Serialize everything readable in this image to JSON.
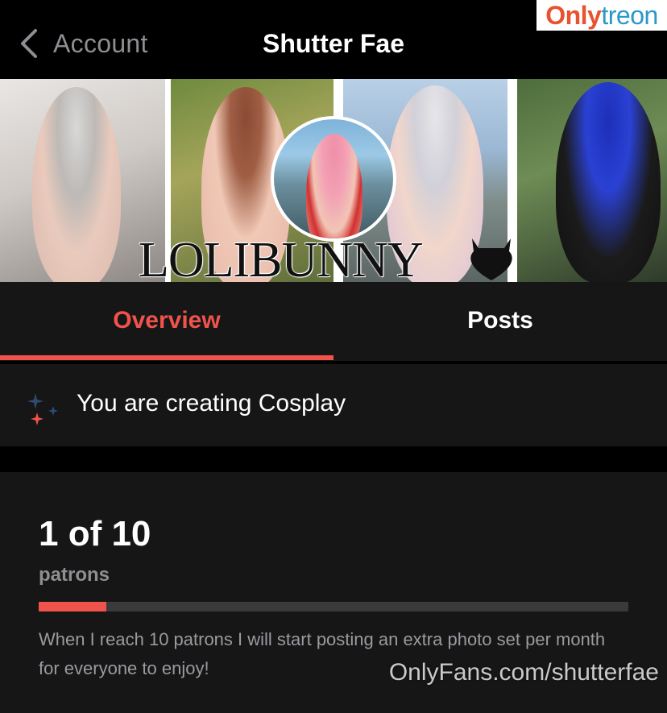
{
  "nav": {
    "back_label": "Account",
    "title": "Shutter Fae"
  },
  "watermark_top": {
    "part1": "Only",
    "part2": "treon"
  },
  "banner": {
    "text": "LOLIBUNNY"
  },
  "tabs": [
    {
      "label": "Overview",
      "active": true
    },
    {
      "label": "Posts",
      "active": false
    }
  ],
  "creating": {
    "text": "You are creating Cosplay",
    "icon": "sparkle-icon"
  },
  "goal": {
    "count": "1 of 10",
    "unit": "patrons",
    "progress_fraction": 0.115,
    "description": "When I reach 10 patrons I will start posting an extra photo set per month for everyone to enjoy!"
  },
  "watermark_bottom": "OnlyFans.com/shutterfae",
  "colors": {
    "accent": "#f0534b",
    "background": "#000000",
    "surface": "#161617",
    "muted_text": "#8e8e93"
  }
}
